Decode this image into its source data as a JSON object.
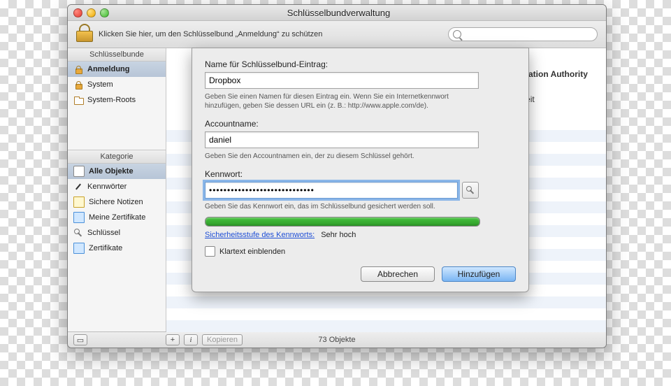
{
  "window": {
    "title": "Schlüsselbundverwaltung",
    "lock_hint": "Klicken Sie hier, um den Schlüsselbund „Anmeldung“ zu schützen"
  },
  "search": {
    "placeholder": ""
  },
  "sidebar": {
    "keychains_header": "Schlüsselbunde",
    "keychains": [
      {
        "label": "Anmeldung"
      },
      {
        "label": "System"
      },
      {
        "label": "System-Roots"
      }
    ],
    "categories_header": "Kategorie",
    "categories": [
      {
        "label": "Alle Objekte"
      },
      {
        "label": "Kennwörter"
      },
      {
        "label": "Sichere Notizen"
      },
      {
        "label": "Meine Zertifikate"
      },
      {
        "label": "Schlüssel"
      },
      {
        "label": "Zertifikate"
      }
    ]
  },
  "background_detail": {
    "cert_tail": "ration Certification Authority",
    "time_tail": "che Sommerzeit"
  },
  "sheet": {
    "name_label": "Name für Schlüsselbund-Eintrag:",
    "name_value": "Dropbox",
    "name_hint": "Geben Sie einen Namen für diesen Eintrag ein. Wenn Sie ein Internetkennwort hinzufügen, geben Sie dessen URL ein (z. B.: http://www.apple.com/de).",
    "account_label": "Accountname:",
    "account_value": "daniel",
    "account_hint": "Geben Sie den Accountnamen ein, der zu diesem Schlüssel gehört.",
    "password_label": "Kennwort:",
    "password_value": "•••••••••••••••••••••••••••••",
    "password_hint": "Geben Sie das Kennwort ein, das im Schlüsselbund gesichert werden soll.",
    "strength_link": "Sicherheitsstufe des Kennworts:",
    "strength_value": "Sehr hoch",
    "show_plain": "Klartext einblenden",
    "cancel": "Abbrechen",
    "add": "Hinzufügen"
  },
  "footer": {
    "copy_label": "Kopieren",
    "object_count": "73 Objekte"
  }
}
